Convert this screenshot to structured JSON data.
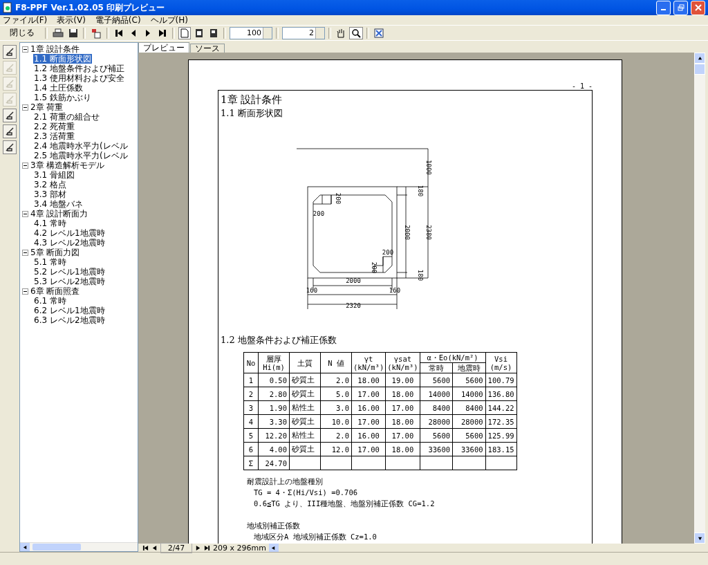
{
  "window": {
    "title": "F8-PPF Ver.1.02.05 印刷プレビュー"
  },
  "menu": [
    "ファイル(F)",
    "表示(V)",
    "電子納品(C)",
    "ヘルプ(H)"
  ],
  "toolbar": {
    "close_label": "閉じる",
    "zoom": "100",
    "page": "2"
  },
  "side_tools": [
    {
      "disabled": false
    },
    {
      "disabled": true
    },
    {
      "disabled": true
    },
    {
      "disabled": true
    },
    {
      "disabled": false
    },
    {
      "disabled": false
    },
    {
      "disabled": false
    }
  ],
  "tree": [
    {
      "label": "1章 設計条件",
      "expanded": true,
      "children": [
        {
          "label": "1.1 断面形状図",
          "selected": true
        },
        {
          "label": "1.2 地盤条件および補正",
          "selected": false
        },
        {
          "label": "1.3 使用材料および安全",
          "selected": false
        },
        {
          "label": "1.4 土圧係数",
          "selected": false
        },
        {
          "label": "1.5 鉄筋かぶり",
          "selected": false
        }
      ]
    },
    {
      "label": "2章 荷重",
      "expanded": true,
      "children": [
        {
          "label": "2.1 荷重の組合せ",
          "selected": false
        },
        {
          "label": "2.2 死荷重",
          "selected": false
        },
        {
          "label": "2.3 活荷重",
          "selected": false
        },
        {
          "label": "2.4 地震時水平力(レベル",
          "selected": false
        },
        {
          "label": "2.5 地震時水平力(レベル",
          "selected": false
        }
      ]
    },
    {
      "label": "3章 構造解析モデル",
      "expanded": true,
      "children": [
        {
          "label": "3.1 骨組図",
          "selected": false
        },
        {
          "label": "3.2 格点",
          "selected": false
        },
        {
          "label": "3.3 部材",
          "selected": false
        },
        {
          "label": "3.4 地盤バネ",
          "selected": false
        }
      ]
    },
    {
      "label": "4章 設計断面力",
      "expanded": true,
      "children": [
        {
          "label": "4.1 常時",
          "selected": false
        },
        {
          "label": "4.2 レベル1地震時",
          "selected": false
        },
        {
          "label": "4.3 レベル2地震時",
          "selected": false
        }
      ]
    },
    {
      "label": "5章 断面力図",
      "expanded": true,
      "children": [
        {
          "label": "5.1 常時",
          "selected": false
        },
        {
          "label": "5.2 レベル1地震時",
          "selected": false
        },
        {
          "label": "5.3 レベル2地震時",
          "selected": false
        }
      ]
    },
    {
      "label": "6章 断面照査",
      "expanded": true,
      "children": [
        {
          "label": "6.1 常時",
          "selected": false
        },
        {
          "label": "6.2 レベル1地震時",
          "selected": false
        },
        {
          "label": "6.3 レベル2地震時",
          "selected": false
        }
      ]
    }
  ],
  "tabs": [
    {
      "label": "プレビュー",
      "selected": true
    },
    {
      "label": "ソース",
      "selected": false
    }
  ],
  "page": {
    "page_number": "- 1 -",
    "chapter": "1章 設計条件",
    "section_1": "1.1 断面形状図",
    "drawing_labels": [
      "1000",
      "180",
      "2000",
      "2380",
      "180",
      "200",
      "200",
      "200",
      "200",
      "2000",
      "160",
      "160",
      "2320"
    ],
    "section_2": "1.2 地盤条件および補正係数",
    "table": {
      "headers": [
        "No",
        "層厚\nHi(m)",
        "土質",
        "N 値",
        "γt\n(kN/m³)",
        "γsat\n(kN/m³)",
        "α・Eo(kN/m²)",
        "Vsi\n(m/s)"
      ],
      "subheaders": [
        "常時",
        "地震時"
      ],
      "rows": [
        [
          "1",
          "0.50",
          "砂質土",
          "2.0",
          "18.00",
          "19.00",
          "5600",
          "5600",
          "100.79"
        ],
        [
          "2",
          "2.80",
          "砂質土",
          "5.0",
          "17.00",
          "18.00",
          "14000",
          "14000",
          "136.80"
        ],
        [
          "3",
          "1.90",
          "粘性土",
          "3.0",
          "16.00",
          "17.00",
          "8400",
          "8400",
          "144.22"
        ],
        [
          "4",
          "3.30",
          "砂質土",
          "10.0",
          "17.00",
          "18.00",
          "28000",
          "28000",
          "172.35"
        ],
        [
          "5",
          "12.20",
          "粘性土",
          "2.0",
          "16.00",
          "17.00",
          "5600",
          "5600",
          "125.99"
        ],
        [
          "6",
          "4.00",
          "砂質土",
          "12.0",
          "17.00",
          "18.00",
          "33600",
          "33600",
          "183.15"
        ]
      ],
      "total": [
        "Σ",
        "24.70"
      ]
    },
    "notes": [
      {
        "kind": "heading",
        "text": "耐震設計上の地盤種別"
      },
      {
        "kind": "line",
        "text": "TG = 4・Σ(Hi/Vsi) =0.706"
      },
      {
        "kind": "line",
        "text": "0.6≦TG より、III種地盤、地盤別補正係数 CG=1.2"
      },
      {
        "kind": "gap"
      },
      {
        "kind": "heading",
        "text": "地域別補正係数"
      },
      {
        "kind": "line",
        "text": "地域区分A 地域別補正係数 Cz=1.0"
      }
    ]
  },
  "nav": {
    "page": "2/47",
    "paper_size": "209 x 296mm"
  }
}
